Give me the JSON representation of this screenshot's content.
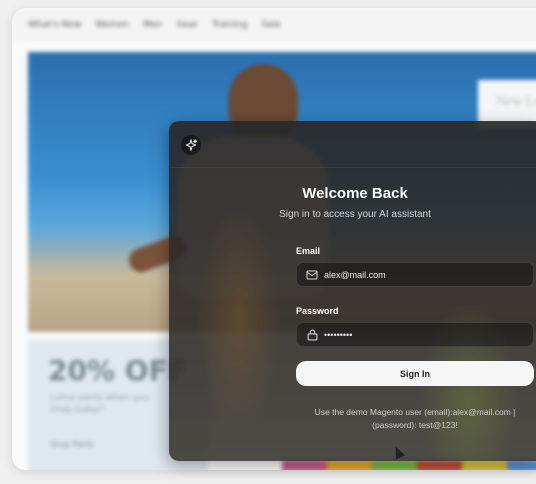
{
  "storefront": {
    "nav": [
      "What's New",
      "Women",
      "Men",
      "Gear",
      "Training",
      "Sale"
    ],
    "hero_sign": "New Luma",
    "promo_title": "20% OFF",
    "promo_sub": "Luma pants when you shop today*",
    "promo_link": "Shop Pants"
  },
  "dialog": {
    "logo_icon": "sparkle-icon",
    "title": "Welcome Back",
    "subtitle": "Sign in to access your AI assistant",
    "email_label": "Email",
    "email_value": "alex@mail.com",
    "email_icon": "mail-icon",
    "password_label": "Password",
    "password_value": "test@123!",
    "password_icon": "lock-icon",
    "sign_in_label": "Sign In",
    "hint_line1": "Use the demo Magento user (email):alex@mail.com |",
    "hint_line2": "(password): test@123!"
  },
  "colors": {
    "swatches": [
      "#c75b8a",
      "#e0a72a",
      "#7bb640",
      "#c24b3b",
      "#d4c23a",
      "#5a8fd0"
    ]
  }
}
